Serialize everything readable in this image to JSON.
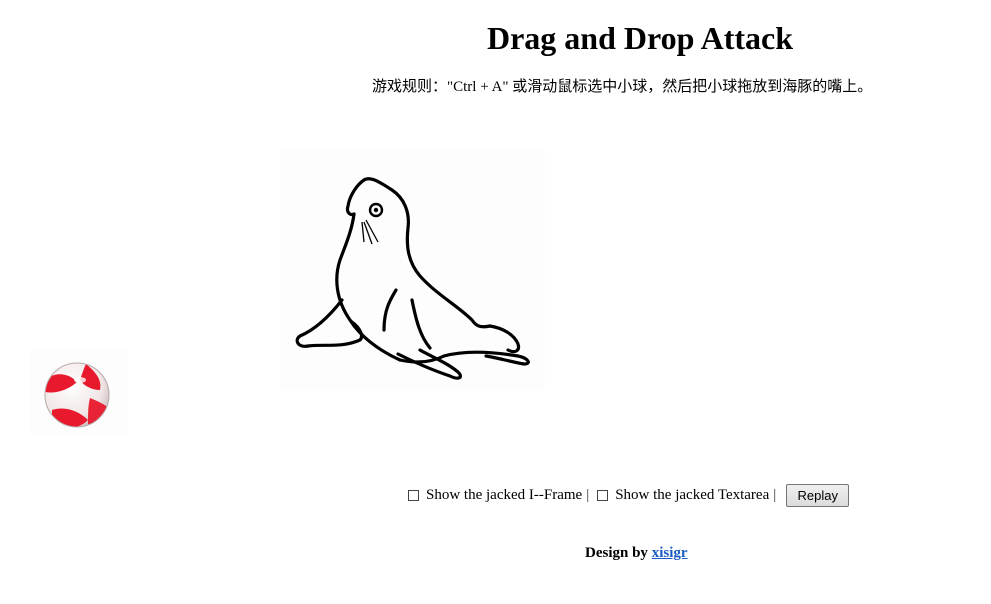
{
  "header": {
    "title": "Drag and Drop Attack",
    "rules": "游戏规则：\"Ctrl + A\" 或滑动鼠标选中小球，然后把小球拖放到海豚的嘴上。"
  },
  "images": {
    "seal": "seal-drawing",
    "ball": "beach-ball"
  },
  "controls": {
    "iframe_label": "Show the jacked I--Frame",
    "textarea_label": "Show the jacked Textarea",
    "separator": "|",
    "replay_label": "Replay"
  },
  "footer": {
    "design_prefix": "Design by",
    "author_link": "xisigr"
  },
  "colors": {
    "link": "#1a5cc4",
    "ball_red": "#e8192c"
  }
}
